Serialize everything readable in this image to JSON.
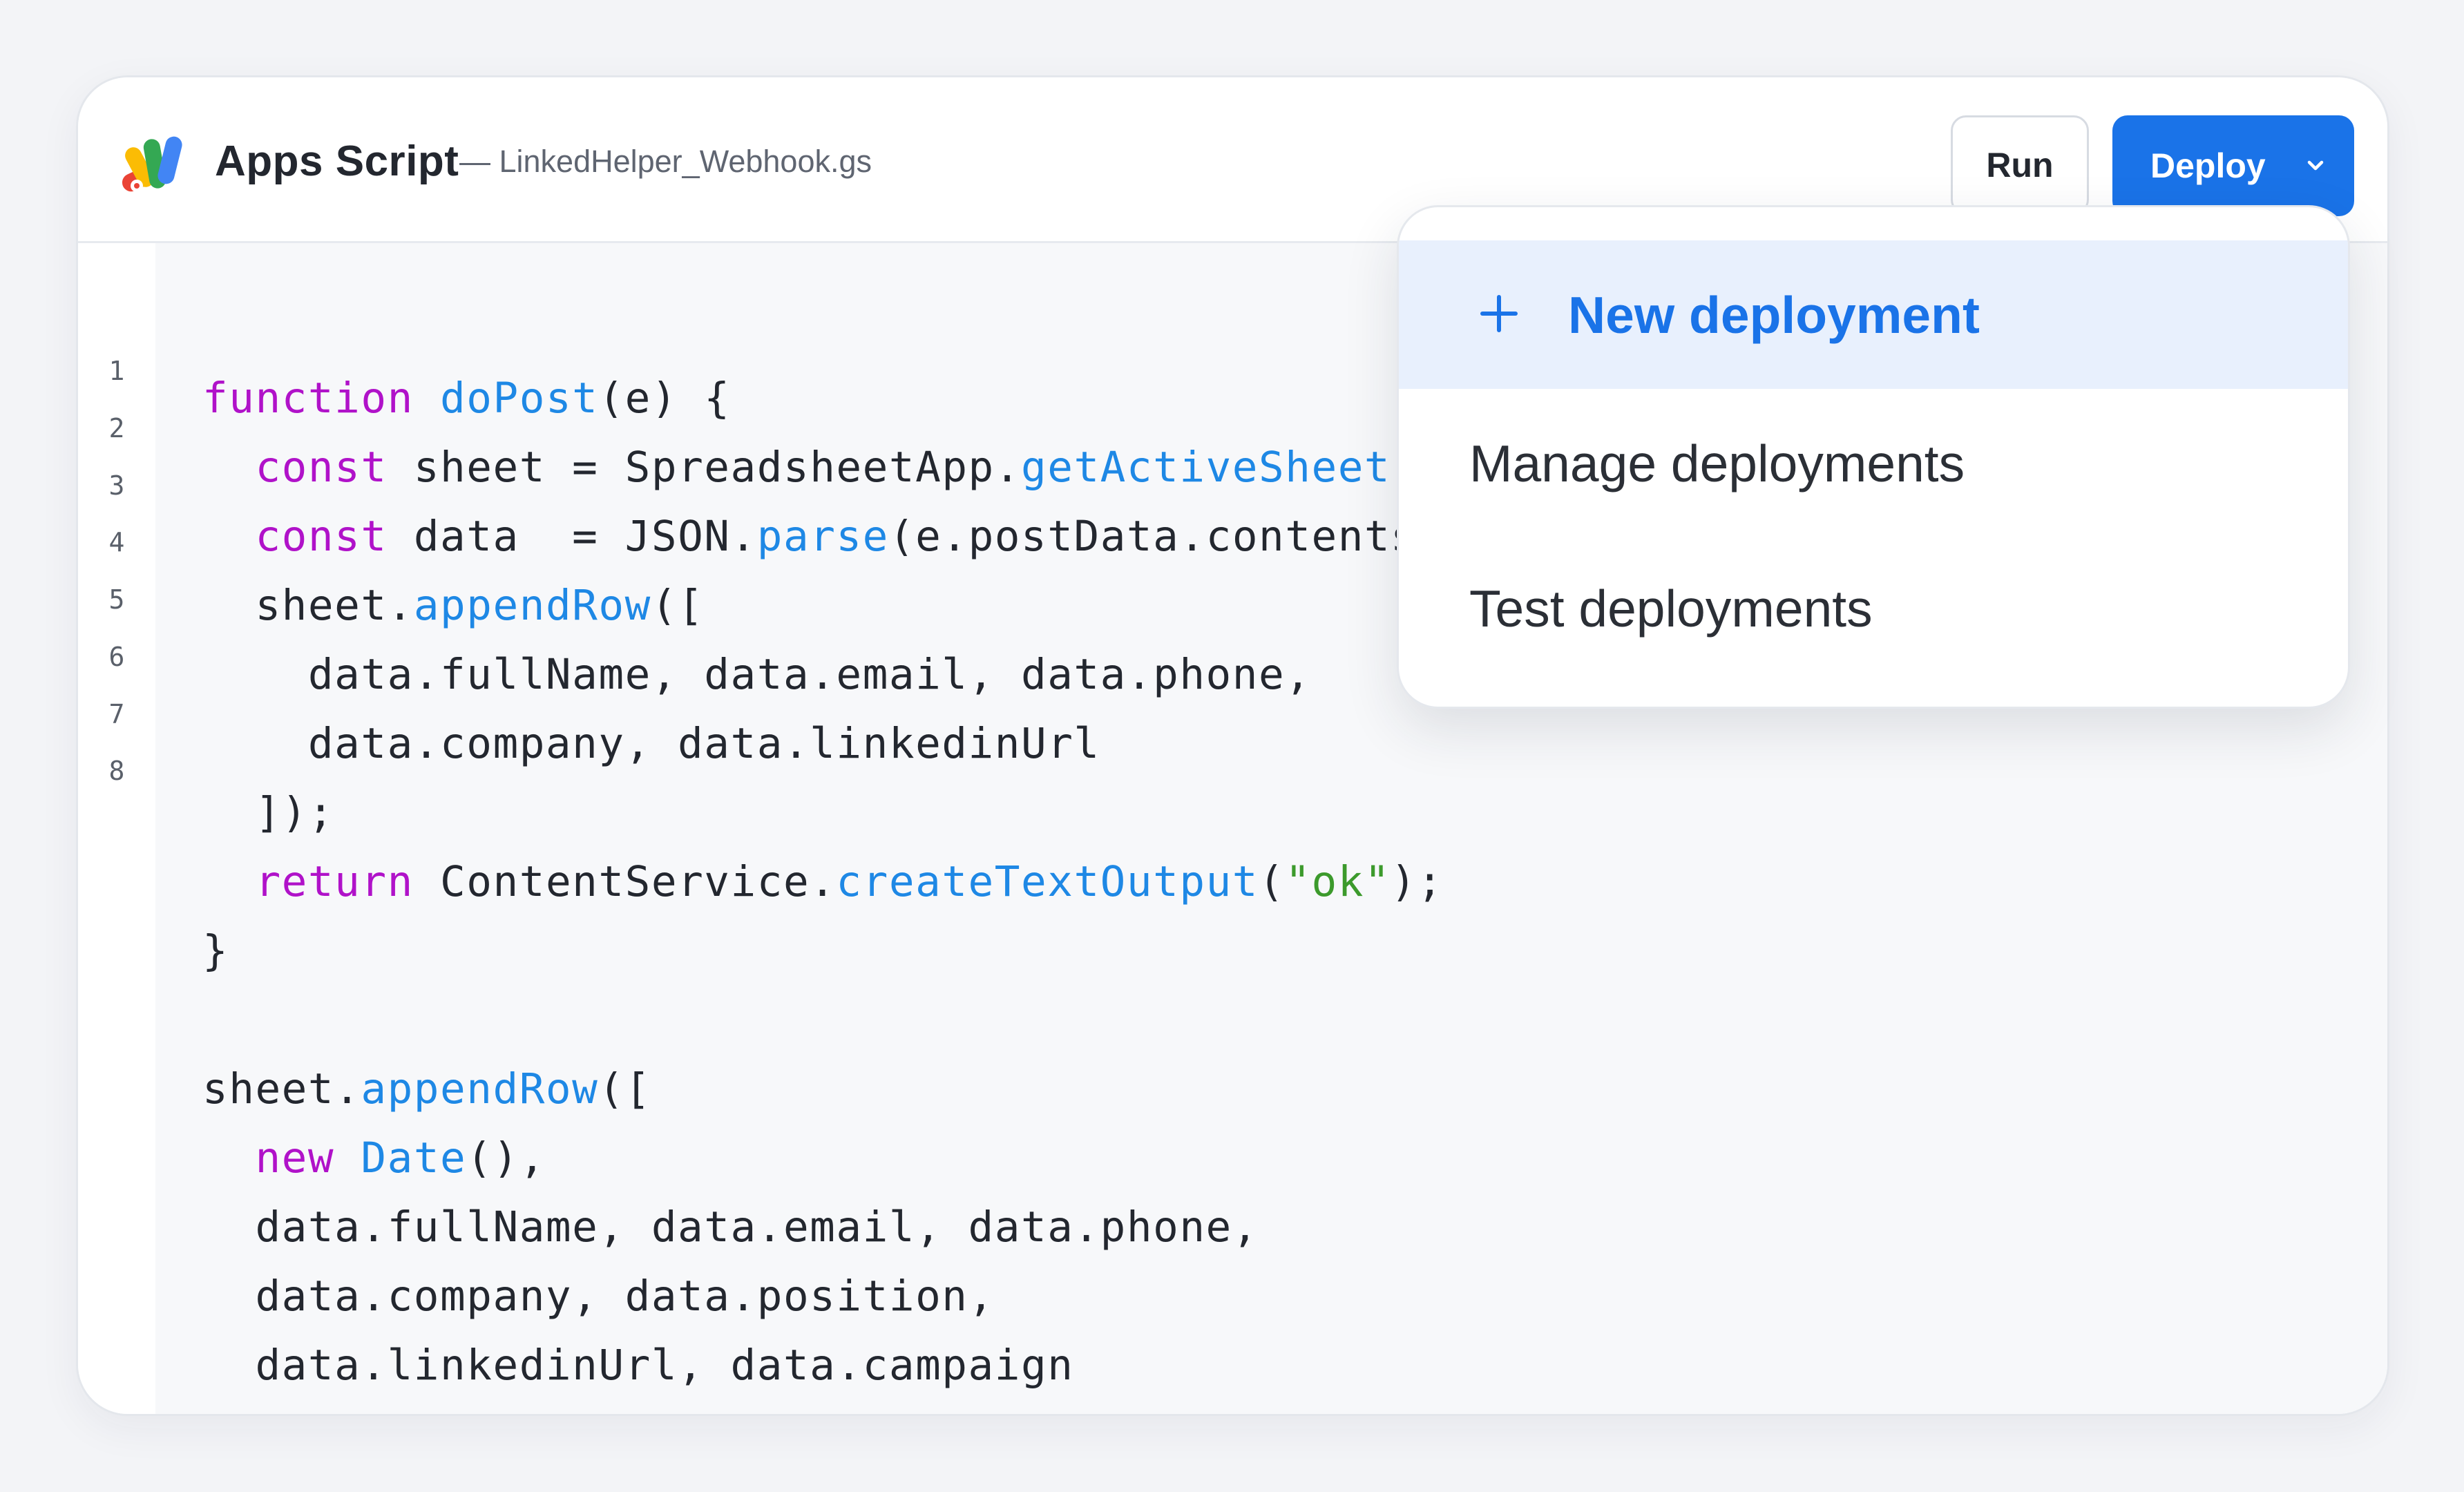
{
  "header": {
    "app_title": "Apps Script",
    "file_name": "— LinkedHelper_Webhook.gs",
    "run_label": "Run",
    "deploy_label": "Deploy"
  },
  "icons": {
    "logo": "apps-script-logo-icon",
    "deploy_caret": "chevron-down-icon",
    "new_deployment": "plus-icon"
  },
  "colors": {
    "accent": "#1a73e8",
    "keyword": "#b012c9",
    "function": "#1e88e5",
    "string": "#3c9a2c"
  },
  "editor": {
    "line_numbers": [
      "1",
      "2",
      "3",
      "4",
      "5",
      "6",
      "7",
      "8"
    ],
    "code_lines": [
      [
        {
          "t": "kw",
          "v": "function"
        },
        {
          "t": "p",
          "v": " "
        },
        {
          "t": "fn",
          "v": "doPost"
        },
        {
          "t": "p",
          "v": "(e) {"
        }
      ],
      [
        {
          "t": "p",
          "v": "  "
        },
        {
          "t": "kw",
          "v": "const"
        },
        {
          "t": "p",
          "v": " sheet = SpreadsheetApp."
        },
        {
          "t": "fn",
          "v": "getActiveSheet"
        },
        {
          "t": "p",
          "v": "("
        }
      ],
      [
        {
          "t": "p",
          "v": "  "
        },
        {
          "t": "kw",
          "v": "const"
        },
        {
          "t": "p",
          "v": " data  = JSON."
        },
        {
          "t": "fn",
          "v": "parse"
        },
        {
          "t": "p",
          "v": "(e.postData.contents"
        }
      ],
      [
        {
          "t": "p",
          "v": "  sheet."
        },
        {
          "t": "fn",
          "v": "appendRow"
        },
        {
          "t": "p",
          "v": "(["
        }
      ],
      [
        {
          "t": "p",
          "v": "    data.fullName, data.email, data.phone,"
        }
      ],
      [
        {
          "t": "p",
          "v": "    data.company, data.linkedinUrl"
        }
      ],
      [
        {
          "t": "p",
          "v": "  ]);"
        }
      ],
      [
        {
          "t": "p",
          "v": "  "
        },
        {
          "t": "kw",
          "v": "return"
        },
        {
          "t": "p",
          "v": " ContentService."
        },
        {
          "t": "fn",
          "v": "createTextOutput"
        },
        {
          "t": "p",
          "v": "("
        },
        {
          "t": "str",
          "v": "\"ok\""
        },
        {
          "t": "p",
          "v": ");"
        }
      ],
      [
        {
          "t": "p",
          "v": "}"
        }
      ],
      [
        {
          "t": "p",
          "v": ""
        }
      ],
      [
        {
          "t": "p",
          "v": "sheet."
        },
        {
          "t": "fn",
          "v": "appendRow"
        },
        {
          "t": "p",
          "v": "(["
        }
      ],
      [
        {
          "t": "p",
          "v": "  "
        },
        {
          "t": "kw",
          "v": "new"
        },
        {
          "t": "p",
          "v": " "
        },
        {
          "t": "fn",
          "v": "Date"
        },
        {
          "t": "p",
          "v": "(),"
        }
      ],
      [
        {
          "t": "p",
          "v": "  data.fullName, data.email, data.phone,"
        }
      ],
      [
        {
          "t": "p",
          "v": "  data.company, data.position,"
        }
      ],
      [
        {
          "t": "p",
          "v": "  data.linkedinUrl, data.campaign"
        }
      ],
      [
        {
          "t": "p",
          "v": "]);"
        }
      ]
    ]
  },
  "deploy_menu": {
    "items": [
      {
        "label": "New deployment",
        "active": true
      },
      {
        "label": "Manage deployments",
        "active": false
      },
      {
        "label": "Test deployments",
        "active": false
      }
    ]
  }
}
